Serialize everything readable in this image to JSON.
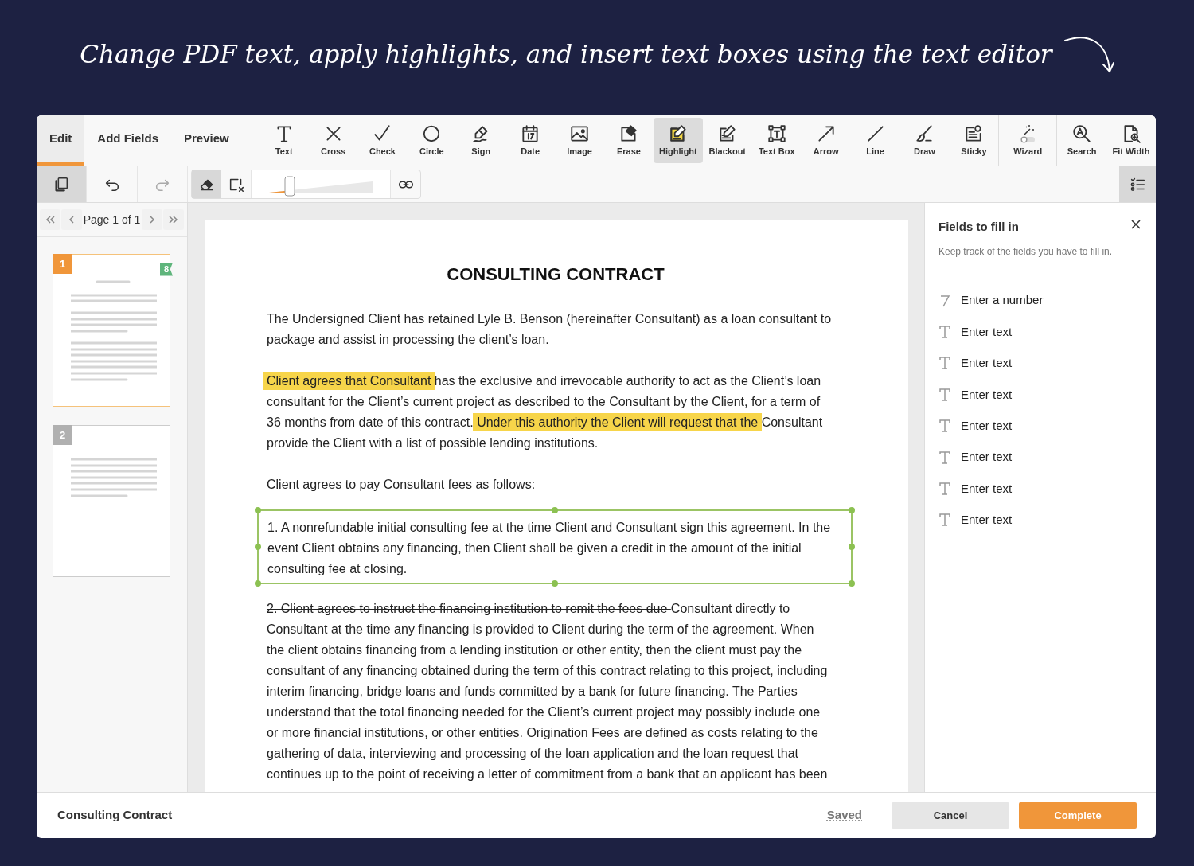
{
  "headline": "Change PDF text, apply highlights, and insert text boxes using the text editor",
  "tabs": [
    {
      "label": "Edit",
      "selected": true
    },
    {
      "label": "Add Fields",
      "selected": false
    },
    {
      "label": "Preview",
      "selected": false
    }
  ],
  "tools": [
    {
      "kind": "text",
      "label": "Text",
      "selected": false
    },
    {
      "kind": "cross",
      "label": "Cross",
      "selected": false
    },
    {
      "kind": "check",
      "label": "Check",
      "selected": false
    },
    {
      "kind": "circle",
      "label": "Circle",
      "selected": false
    },
    {
      "kind": "sign",
      "label": "Sign",
      "selected": false
    },
    {
      "kind": "date",
      "label": "Date",
      "selected": false
    },
    {
      "kind": "image",
      "label": "Image",
      "selected": false
    },
    {
      "kind": "erase",
      "label": "Erase",
      "selected": false
    },
    {
      "kind": "highlight",
      "label": "Highlight",
      "selected": true
    },
    {
      "kind": "blackout",
      "label": "Blackout",
      "selected": false
    },
    {
      "kind": "textbox",
      "label": "Text Box",
      "selected": false
    },
    {
      "kind": "arrow",
      "label": "Arrow",
      "selected": false
    },
    {
      "kind": "line",
      "label": "Line",
      "selected": false
    },
    {
      "kind": "draw",
      "label": "Draw",
      "selected": false
    },
    {
      "kind": "sticky",
      "label": "Sticky",
      "selected": false
    }
  ],
  "wizard": {
    "label": "Wizard",
    "on": false
  },
  "view_tools": [
    {
      "kind": "search",
      "label": "Search"
    },
    {
      "kind": "fitwidth",
      "label": "Fit Width"
    }
  ],
  "subtoolbar": {
    "pages_panel_open": true,
    "redo_disabled": true,
    "modes": [
      {
        "kind": "eraser",
        "selected": true
      },
      {
        "kind": "clearbox",
        "selected": false
      }
    ],
    "slider": {
      "level": 0.2
    }
  },
  "pager": {
    "label": "Page 1 of 1"
  },
  "thumbnails": [
    {
      "number": "1",
      "selected": true,
      "badge": "8",
      "kind": "full"
    },
    {
      "number": "2",
      "selected": false,
      "kind": "short"
    }
  ],
  "document": {
    "title": "CONSULTING CONTRACT",
    "paragraphs": [
      {
        "kind": "text",
        "segments": [
          {
            "kind": "plain",
            "text": "The Undersigned Client has retained Lyle B. Benson (hereinafter Consultant) as a loan consultant to package and assist in processing the client’s loan."
          }
        ]
      },
      {
        "kind": "text",
        "segments": [
          {
            "kind": "highlight",
            "text": "Client agrees that Consultant"
          },
          {
            "kind": "plain",
            "text": " has the exclusive and irrevocable authority to act as the Client’s loan consultant for the Client’s current project as described to the Consultant by the Client, for a term of 36 months from date of this contract. "
          },
          {
            "kind": "highlight",
            "text": "Under this authority the Client will request that the"
          },
          {
            "kind": "plain",
            "text": " Consultant provide the Client with a list of possible lending institutions."
          }
        ]
      },
      {
        "kind": "text",
        "segments": [
          {
            "kind": "plain",
            "text": "Client agrees to pay Consultant fees as follows:"
          }
        ]
      },
      {
        "kind": "selected_box",
        "segments": [
          {
            "kind": "plain",
            "text": "1. A nonrefundable initial consulting fee at the time Client and Consultant sign this agreement. In the event Client obtains any financing, then Client shall be given a credit in the amount of the initial consulting fee at closing."
          }
        ]
      },
      {
        "kind": "text",
        "segments": [
          {
            "kind": "strike",
            "text": "2. Client agrees to instruct the financing institution to remit the fees due "
          },
          {
            "kind": "plain",
            "text": "Consultant directly to Consultant at the time any financing is provided to Client during the term of the agreement. When the client obtains financing from a lending institution or other entity, then the client must pay the consultant of any financing obtained during the term of this contract relating to this project, including interim financing, bridge loans and funds committed by a bank for future financing. The Parties understand that the total financing needed for the Client’s current project may possibly include one or more financial institutions, or other entities.  Origination Fees are defined as costs relating to the gathering of data, interviewing and processing of the loan application and the loan request that continues up to the point of receiving a letter of commitment from a bank that an applicant has been"
          }
        ]
      }
    ]
  },
  "fields_panel": {
    "title": "Fields to fill in",
    "subtitle": "Keep track of the fields you have to fill in.",
    "items": [
      {
        "kind": "number",
        "label": "Enter a number"
      },
      {
        "kind": "text",
        "label": "Enter text"
      },
      {
        "kind": "text",
        "label": "Enter text"
      },
      {
        "kind": "text",
        "label": "Enter text"
      },
      {
        "kind": "text",
        "label": "Enter text"
      },
      {
        "kind": "text",
        "label": "Enter text"
      },
      {
        "kind": "text",
        "label": "Enter text"
      },
      {
        "kind": "text",
        "label": "Enter text"
      }
    ]
  },
  "footer": {
    "document_name": "Consulting Contract",
    "status": "Saved",
    "buttons": [
      {
        "kind": "secondary",
        "label": "Cancel"
      },
      {
        "kind": "primary",
        "label": "Complete"
      }
    ]
  }
}
